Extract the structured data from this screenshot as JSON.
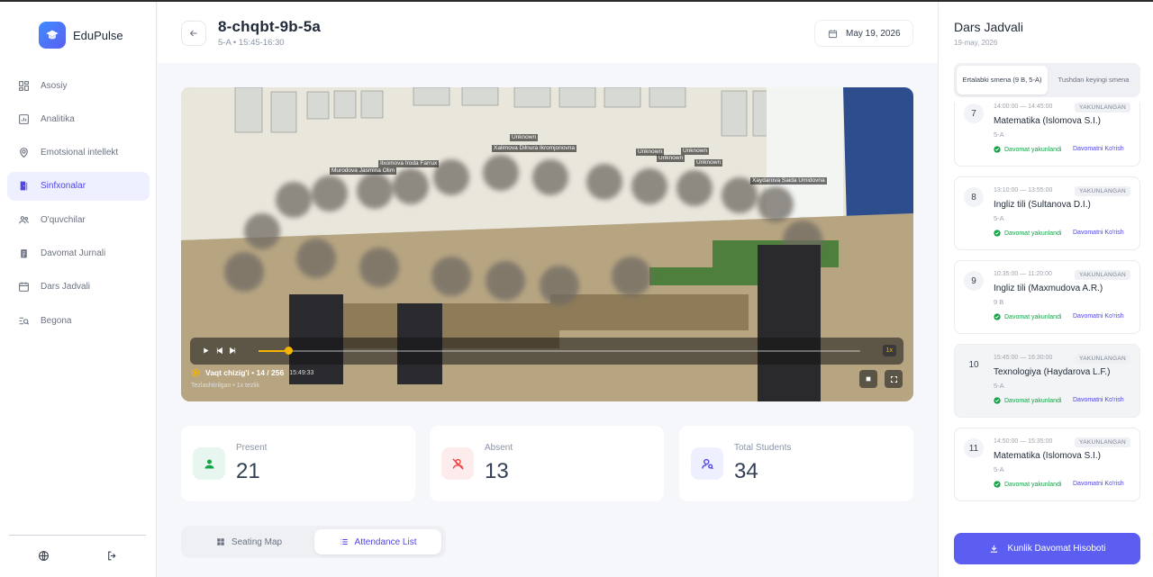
{
  "brand": {
    "name": "EduPulse"
  },
  "sidebar": {
    "items": [
      {
        "label": "Asosiy",
        "icon": "grid-icon"
      },
      {
        "label": "Analitika",
        "icon": "chart-icon"
      },
      {
        "label": "Emotsional intellekt",
        "icon": "brain-icon"
      },
      {
        "label": "Sinfxonalar",
        "icon": "door-icon",
        "active": true
      },
      {
        "label": "O'quvchilar",
        "icon": "users-icon"
      },
      {
        "label": "Davomat Jurnali",
        "icon": "clipboard-icon"
      },
      {
        "label": "Dars Jadvali",
        "icon": "calendar-icon"
      },
      {
        "label": "Begona",
        "icon": "search-list-icon"
      }
    ]
  },
  "header": {
    "title": "8-chqbt-9b-5a",
    "subtitle": "5-A • 15:45-16:30",
    "date": "May 19, 2026"
  },
  "video": {
    "detections": [
      "Unknown",
      "Xalimova Dilnura Ikromjonovna",
      "Unknown",
      "Unknown",
      "Unknown",
      "Unknown",
      "Murodova Jasmina Olim",
      "Ilxomova Iroda Farrux",
      "Xaydarova Saida Umidovna"
    ],
    "progress": 0.05,
    "speed_label": "1x",
    "timeline_label": "Vaqt chizig'i • 14 / 256",
    "timeline_time": "15:49:33",
    "timeline_sub": "Tezlashtirilgan • 1x tezlik"
  },
  "stats": {
    "present": {
      "label": "Present",
      "value": "21"
    },
    "absent": {
      "label": "Absent",
      "value": "13"
    },
    "total": {
      "label": "Total Students",
      "value": "34"
    }
  },
  "tabs": {
    "seating": "Seating Map",
    "attendance": "Attendance List"
  },
  "schedule": {
    "title": "Dars Jadvali",
    "date": "19-may, 2026",
    "shift_morning": "Ertalabki smena (9 B, 5-A)",
    "shift_afternoon": "Tushdan keyingi smena",
    "lessons": [
      {
        "num": "7",
        "time": "14:00:00 — 14:45:00",
        "badge": "YAKUNLANGAN",
        "name": "Matematika (Islomova S.I.)",
        "class": "5-A",
        "status": "Davomat yakunlandi",
        "link": "Davomatni Ko'rish"
      },
      {
        "num": "8",
        "time": "13:10:00 — 13:55:00",
        "badge": "YAKUNLANGAN",
        "name": "Ingliz tili (Sultanova D.I.)",
        "class": "5-A",
        "status": "Davomat yakunlandi",
        "link": "Davomatni Ko'rish"
      },
      {
        "num": "9",
        "time": "10:35:00 — 11:20:00",
        "badge": "YAKUNLANGAN",
        "name": "Ingliz tili (Maxmudova A.R.)",
        "class": "9 B",
        "status": "Davomat yakunlandi",
        "link": "Davomatni Ko'rish"
      },
      {
        "num": "10",
        "time": "15:45:00 — 16:30:00",
        "badge": "YAKUNLANGAN",
        "name": "Texnologiya (Haydarova L.F.)",
        "class": "5-A",
        "status": "Davomat yakunlandi",
        "link": "Davomatni Ko'rish"
      },
      {
        "num": "11",
        "time": "14:50:00 — 15:35:00",
        "badge": "YAKUNLANGAN",
        "name": "Matematika (Islomova S.I.)",
        "class": "5-A",
        "status": "Davomat yakunlandi",
        "link": "Davomatni Ko'rish"
      }
    ],
    "report_button": "Kunlik Davomat Hisoboti"
  },
  "colors": {
    "accent": "#5b5ef0",
    "success": "#16a34a",
    "danger": "#ef4444",
    "playback": "#f5b400"
  }
}
